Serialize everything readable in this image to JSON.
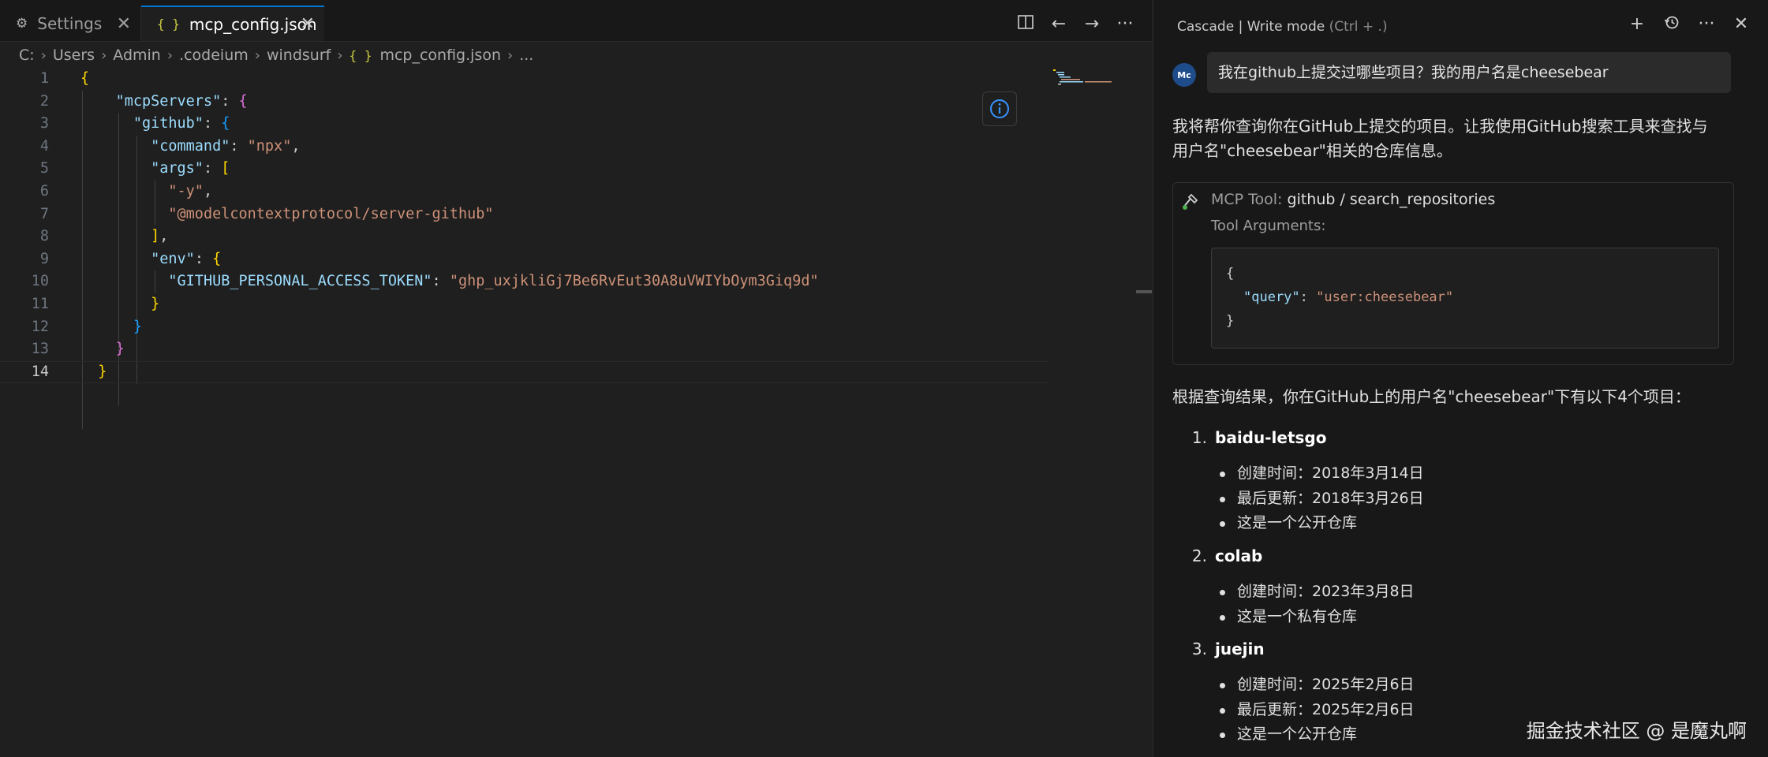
{
  "editor": {
    "tabs": [
      {
        "icon": "settings-icon",
        "label": "Settings"
      },
      {
        "icon": "json-braces-icon",
        "label": "mcp_config.json",
        "active": true
      }
    ],
    "breadcrumb": [
      "C:",
      "Users",
      "Admin",
      ".codeium",
      "windsurf",
      "mcp_config.json",
      "..."
    ],
    "json_icon_glyph": "{ }",
    "code_lines": [
      {
        "n": "1",
        "tokens": [
          {
            "t": "{",
            "c": "b1"
          }
        ]
      },
      {
        "n": "2",
        "tokens": [
          {
            "t": "    ",
            "c": "p"
          },
          {
            "t": "\"mcpServers\"",
            "c": "k"
          },
          {
            "t": ": ",
            "c": "p"
          },
          {
            "t": "{",
            "c": "b2"
          }
        ]
      },
      {
        "n": "3",
        "tokens": [
          {
            "t": "      ",
            "c": "p"
          },
          {
            "t": "\"github\"",
            "c": "k"
          },
          {
            "t": ": ",
            "c": "p"
          },
          {
            "t": "{",
            "c": "b3"
          }
        ]
      },
      {
        "n": "4",
        "tokens": [
          {
            "t": "        ",
            "c": "p"
          },
          {
            "t": "\"command\"",
            "c": "k"
          },
          {
            "t": ": ",
            "c": "p"
          },
          {
            "t": "\"npx\"",
            "c": "s"
          },
          {
            "t": ",",
            "c": "p"
          }
        ]
      },
      {
        "n": "5",
        "tokens": [
          {
            "t": "        ",
            "c": "p"
          },
          {
            "t": "\"args\"",
            "c": "k"
          },
          {
            "t": ": ",
            "c": "p"
          },
          {
            "t": "[",
            "c": "b1"
          }
        ]
      },
      {
        "n": "6",
        "tokens": [
          {
            "t": "          ",
            "c": "p"
          },
          {
            "t": "\"-y\"",
            "c": "s"
          },
          {
            "t": ",",
            "c": "p"
          }
        ]
      },
      {
        "n": "7",
        "tokens": [
          {
            "t": "          ",
            "c": "p"
          },
          {
            "t": "\"@modelcontextprotocol/server-github\"",
            "c": "s"
          }
        ]
      },
      {
        "n": "8",
        "tokens": [
          {
            "t": "        ",
            "c": "p"
          },
          {
            "t": "]",
            "c": "b1"
          },
          {
            "t": ",",
            "c": "p"
          }
        ]
      },
      {
        "n": "9",
        "tokens": [
          {
            "t": "        ",
            "c": "p"
          },
          {
            "t": "\"env\"",
            "c": "k"
          },
          {
            "t": ": ",
            "c": "p"
          },
          {
            "t": "{",
            "c": "b1"
          }
        ]
      },
      {
        "n": "10",
        "tokens": [
          {
            "t": "          ",
            "c": "p"
          },
          {
            "t": "\"GITHUB_PERSONAL_ACCESS_TOKEN\"",
            "c": "k"
          },
          {
            "t": ": ",
            "c": "p"
          },
          {
            "t": "\"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\"",
            "c": "s"
          }
        ]
      },
      {
        "n": "11",
        "tokens": [
          {
            "t": "        ",
            "c": "p"
          },
          {
            "t": "}",
            "c": "b1"
          }
        ]
      },
      {
        "n": "12",
        "tokens": [
          {
            "t": "      ",
            "c": "p"
          },
          {
            "t": "}",
            "c": "b3"
          }
        ]
      },
      {
        "n": "13",
        "tokens": [
          {
            "t": "    ",
            "c": "p"
          },
          {
            "t": "}",
            "c": "b2"
          }
        ]
      },
      {
        "n": "14",
        "tokens": [
          {
            "t": "  ",
            "c": "p"
          },
          {
            "t": "}",
            "c": "b1"
          }
        ],
        "current": true
      }
    ]
  },
  "cascade": {
    "title": "Cascade | Write mode",
    "shortcut": "(Ctrl + .)",
    "avatar_initials": "Mc",
    "user_message": "我在github上提交过哪些项目？我的用户名是cheesebear",
    "reply_line1": "我将帮你查询你在GitHub上提交的项目。让我使用GitHub搜索工具来查找与",
    "reply_line2": "用户名\"cheesebear\"相关的仓库信息。",
    "tool_label": "MCP Tool:",
    "tool_name": "github / search_repositories",
    "tool_args_label": "Tool Arguments:",
    "args": {
      "open": "{",
      "key": "\"query\"",
      "colon": ": ",
      "value": "\"user:cheesebear\"",
      "close": "}"
    },
    "summary": "根据查询结果，你在GitHub上的用户名\"cheesebear\"下有以下4个项目：",
    "repos": [
      {
        "num": "1.",
        "name": "baidu-letsgo",
        "details": [
          "创建时间：2018年3月14日",
          "最后更新：2018年3月26日",
          "这是一个公开仓库"
        ]
      },
      {
        "num": "2.",
        "name": "colab",
        "details": [
          "创建时间：2023年3月8日",
          "这是一个私有仓库"
        ]
      },
      {
        "num": "3.",
        "name": "juejin",
        "details": [
          "创建时间：2025年2月6日",
          "最后更新：2025年2月6日",
          "这是一个公开仓库"
        ]
      }
    ]
  },
  "watermark": "掘金技术社区 @ 是魔丸啊",
  "colors": {
    "accent": "#0078d4",
    "bracket_gold": "#ffd700",
    "json_key": "#9cdcfe",
    "json_string": "#ce9178"
  }
}
